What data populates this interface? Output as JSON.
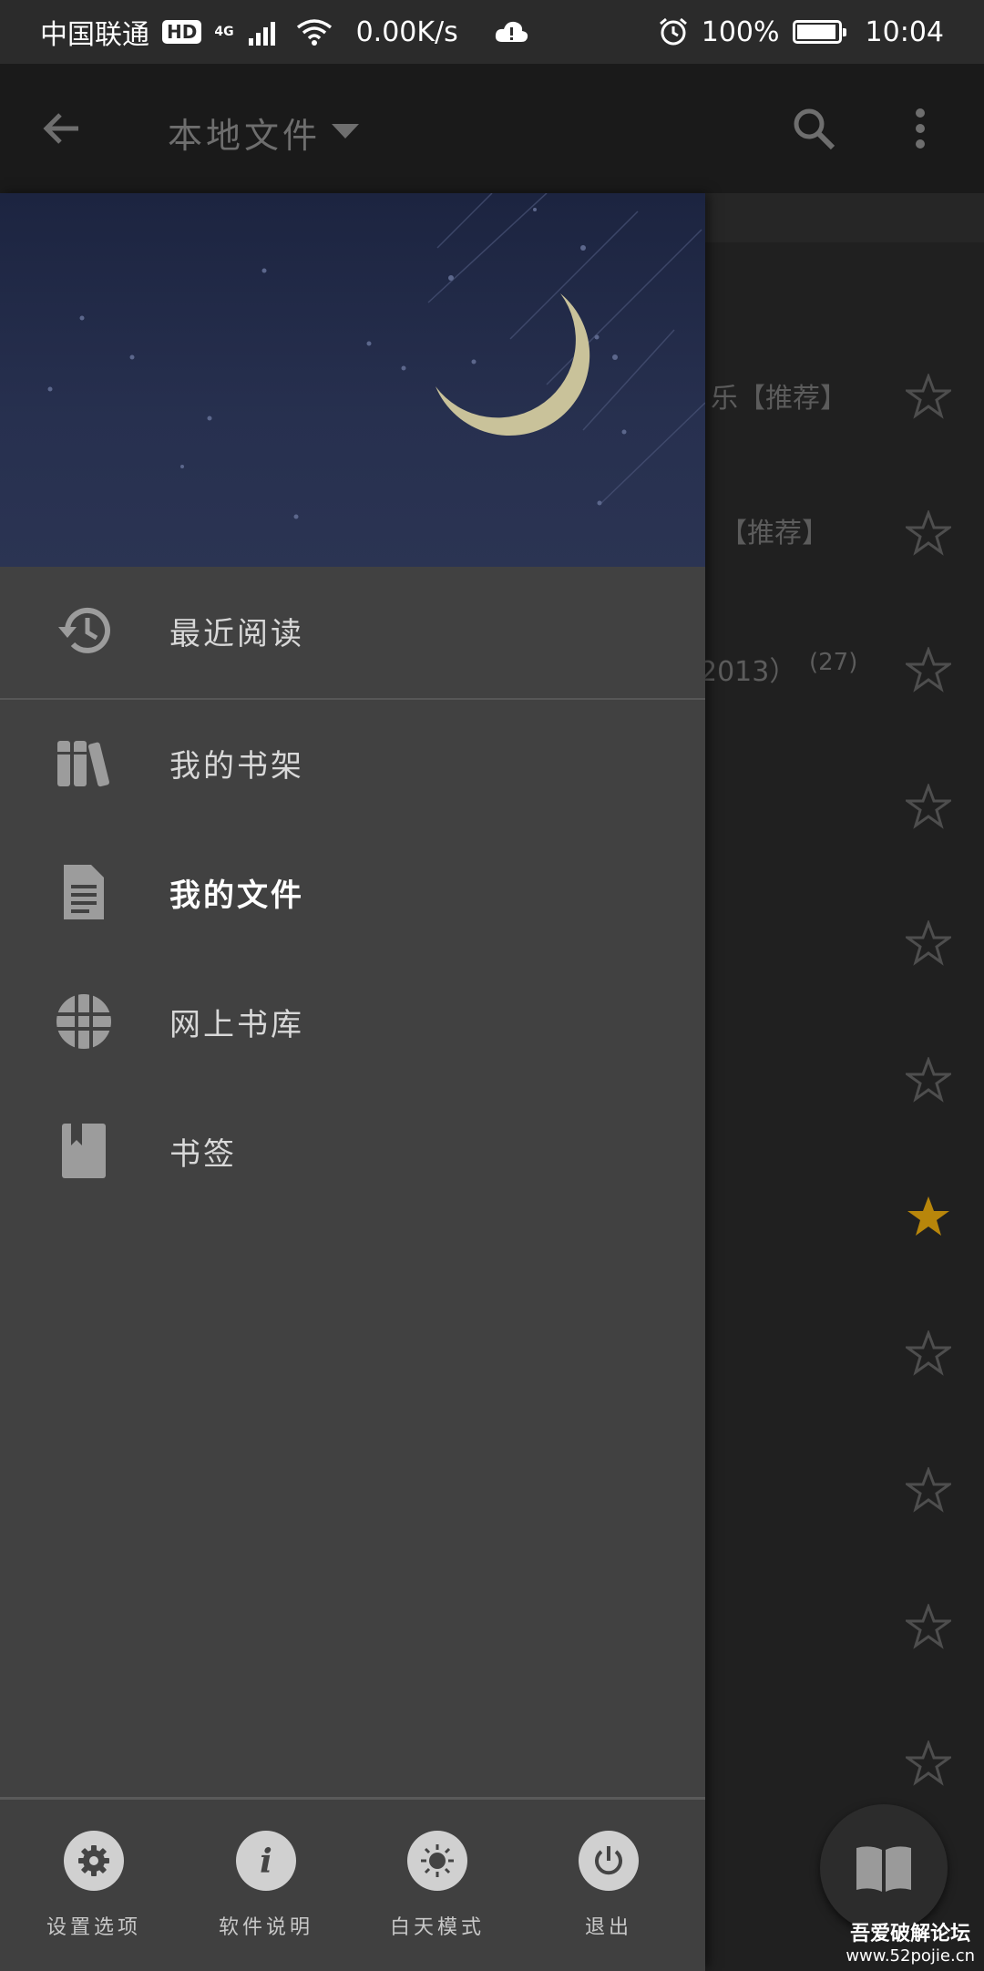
{
  "status_bar": {
    "carrier": "中国联通",
    "hd_badge": "HD",
    "network": "4G",
    "speed": "0.00K/s",
    "battery": "100%",
    "battery_level": 1.0,
    "time": "10:04"
  },
  "app_bar": {
    "title": "本地文件",
    "icons": [
      "back-arrow-icon",
      "dropdown-triangle-icon",
      "search-icon",
      "more-vert-icon"
    ]
  },
  "background_list": {
    "rows": [
      {
        "text": "乐【推荐】",
        "starred": false
      },
      {
        "text": "【推荐】",
        "starred": false
      },
      {
        "text": "2013）",
        "count": "(27)",
        "starred": false
      },
      {
        "text": "",
        "starred": false
      },
      {
        "text": "",
        "starred": false
      },
      {
        "text": "",
        "starred": false
      },
      {
        "text": "",
        "starred": true
      },
      {
        "text": "",
        "starred": false
      },
      {
        "text": "",
        "starred": false
      },
      {
        "text": "",
        "starred": false
      },
      {
        "text": "",
        "starred": false
      }
    ]
  },
  "drawer": {
    "menu": [
      {
        "label": "最近阅读",
        "icon": "history-icon"
      },
      {
        "label": "我的书架",
        "icon": "books-icon"
      },
      {
        "label": "我的文件",
        "icon": "file-icon",
        "active": true
      },
      {
        "label": "网上书库",
        "icon": "globe-icon"
      },
      {
        "label": "书签",
        "icon": "bookmark-icon"
      }
    ],
    "footer": [
      {
        "label": "设置选项",
        "icon": "gear-icon"
      },
      {
        "label": "软件说明",
        "icon": "info-icon"
      },
      {
        "label": "白天模式",
        "icon": "sun-icon"
      },
      {
        "label": "退出",
        "icon": "power-icon"
      }
    ]
  },
  "fab": {
    "icon": "open-book-icon"
  },
  "watermark": {
    "line1": "吾爱破解论坛",
    "line2": "www.52pojie.cn"
  },
  "colors": {
    "drawer_bg": "#414141",
    "header_night": "#27304f",
    "moon": "#c9c29a",
    "starred": "#b8860b"
  }
}
